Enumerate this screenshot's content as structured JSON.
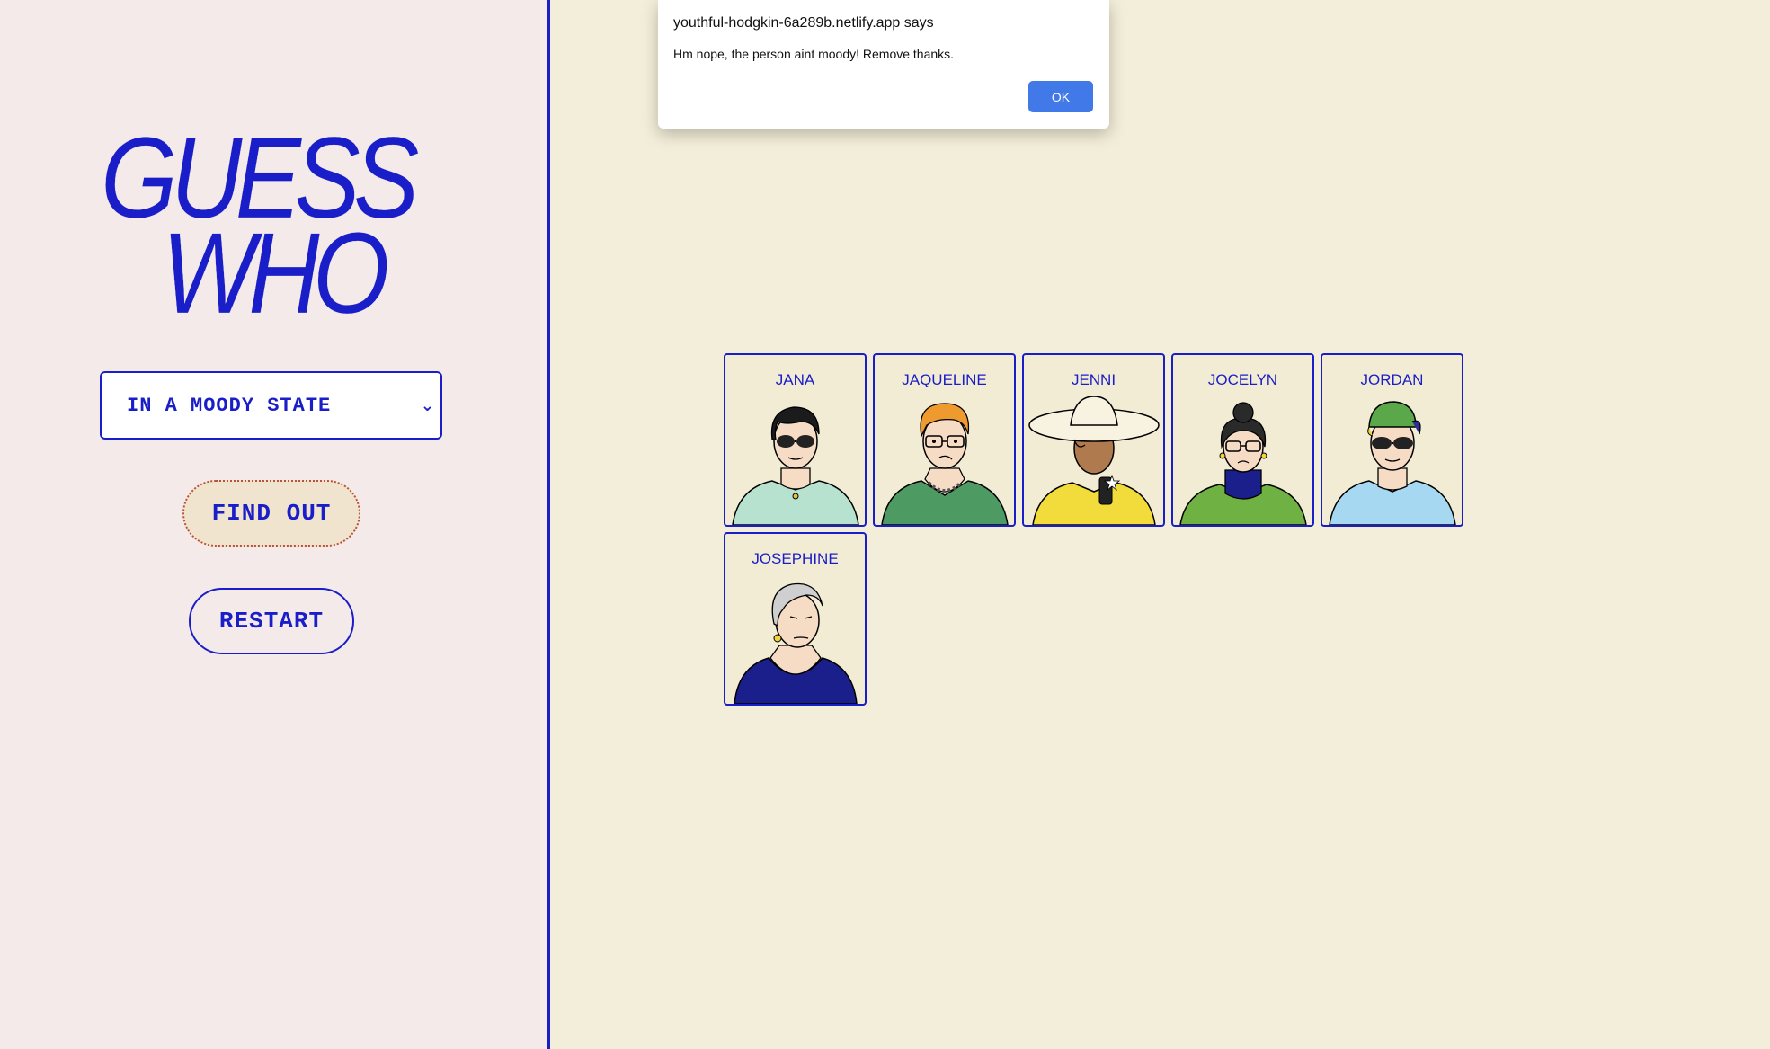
{
  "left_panel": {
    "title_line1": "GUESS",
    "title_line2": "WHO",
    "select_value": "IN A MOODY STATE",
    "find_out_label": "FIND OUT",
    "restart_label": "RESTART"
  },
  "cards": [
    {
      "name": "JANA"
    },
    {
      "name": "JAQUELINE"
    },
    {
      "name": "JENNI"
    },
    {
      "name": "JOCELYN"
    },
    {
      "name": "JORDAN"
    },
    {
      "name": "JOSEPHINE"
    }
  ],
  "dialog": {
    "title": "youthful-hodgkin-6a289b.netlify.app says",
    "message": "Hm nope, the person aint moody! Remove thanks.",
    "ok_label": "OK"
  },
  "colors": {
    "accent_blue": "#1a1ec8",
    "left_bg": "#f4eaea",
    "main_bg": "#f3eed9",
    "ok_button": "#4179e8"
  }
}
